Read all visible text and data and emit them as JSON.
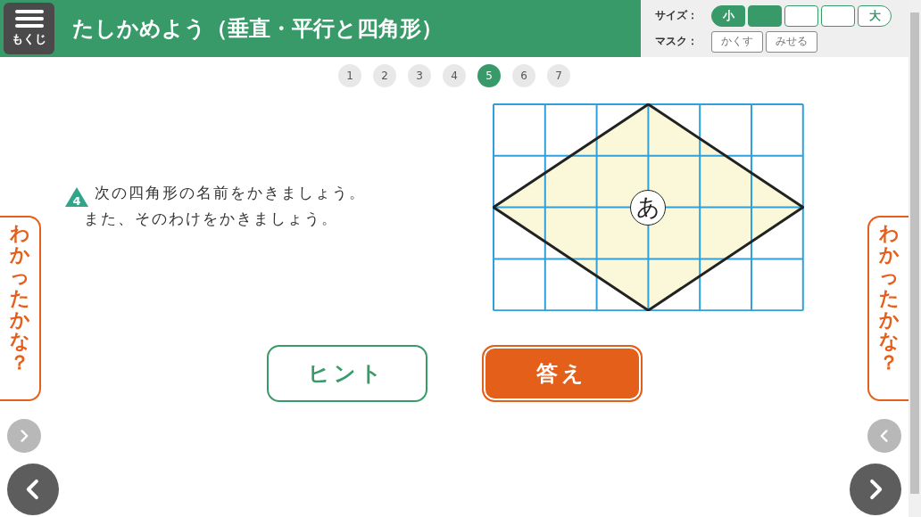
{
  "header": {
    "menu_label": "もくじ",
    "title": "たしかめよう（垂直・平行と四角形）"
  },
  "size": {
    "label": "サイズ：",
    "segments": [
      {
        "label": "小",
        "filled": true
      },
      {
        "filled": true
      },
      {
        "filled": false
      },
      {
        "filled": false
      },
      {
        "label": "大",
        "filled": false
      }
    ]
  },
  "mask": {
    "label": "マスク：",
    "buttons": [
      "かくす",
      "みせる"
    ]
  },
  "pages": [
    {
      "label": "1",
      "selected": false
    },
    {
      "label": "2",
      "selected": false
    },
    {
      "label": "3",
      "selected": false
    },
    {
      "label": "4",
      "selected": false
    },
    {
      "label": "5",
      "selected": true
    },
    {
      "label": "6",
      "selected": false
    },
    {
      "label": "7",
      "selected": false
    }
  ],
  "question": {
    "number": "4",
    "lines": [
      "次の四角形の名前をかきましょう。",
      "また、そのわけをかきましょう。"
    ]
  },
  "figure": {
    "label": "あ"
  },
  "buttons": [
    {
      "label": "ヒント",
      "kind": "outline"
    },
    {
      "label": "答え",
      "kind": "solid"
    }
  ],
  "side_tabs": {
    "left": "わかったかな？",
    "right": "わかったかな？"
  }
}
